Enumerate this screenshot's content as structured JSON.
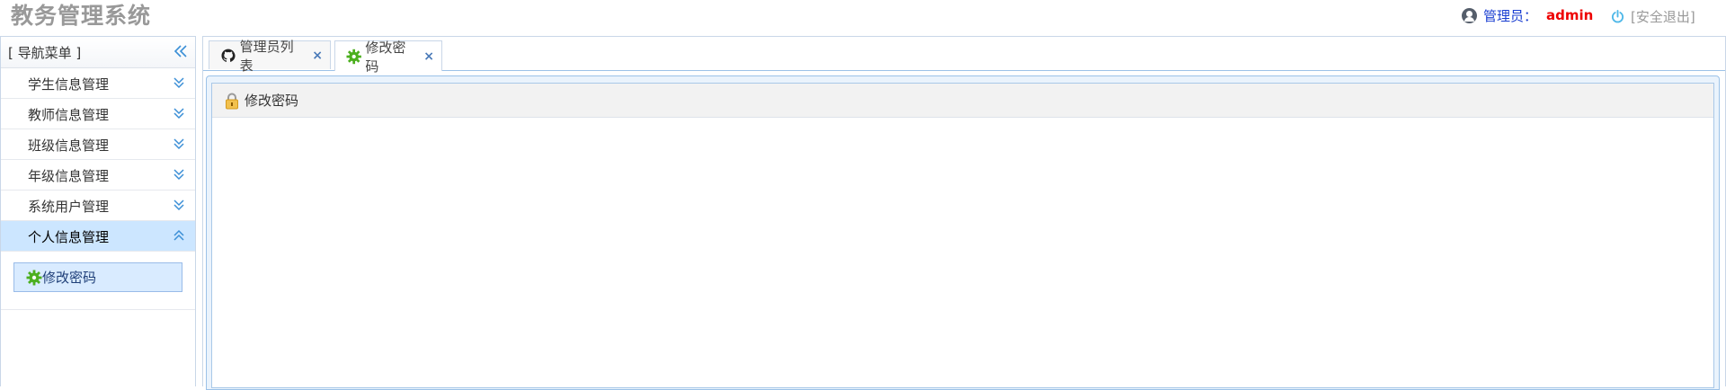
{
  "header": {
    "app_title": "教务管理系统",
    "user_label": "管理员：",
    "user_name": "admin",
    "logout_label": "[安全退出]"
  },
  "sidebar": {
    "title": "[ 导航菜单 ]",
    "items": [
      {
        "label": "学生信息管理",
        "expanded": false
      },
      {
        "label": "教师信息管理",
        "expanded": false
      },
      {
        "label": "班级信息管理",
        "expanded": false
      },
      {
        "label": "年级信息管理",
        "expanded": false
      },
      {
        "label": "系统用户管理",
        "expanded": false
      },
      {
        "label": "个人信息管理",
        "expanded": true
      }
    ],
    "submenu": [
      {
        "label": "修改密码",
        "icon": "gear-icon"
      }
    ]
  },
  "tabs": [
    {
      "label": "管理员列表",
      "icon": "github-icon",
      "close": "×"
    },
    {
      "label": "修改密码",
      "icon": "gear-icon",
      "close": "×",
      "selected": true
    }
  ],
  "panel": {
    "title": "修改密码",
    "icon": "lock-icon"
  },
  "colors": {
    "accent": "#9cc2e8",
    "active_item_bg": "#cce6ff",
    "username": "#ee0000",
    "user_label": "#1a3ed1"
  }
}
